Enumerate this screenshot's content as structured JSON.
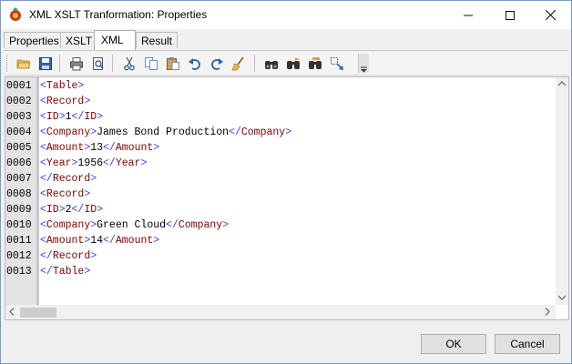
{
  "window": {
    "title": "XML XSLT Tranformation: Properties"
  },
  "tabs": [
    {
      "label": "Properties"
    },
    {
      "label": "XSLT"
    },
    {
      "label": "XML"
    },
    {
      "label": "Result"
    }
  ],
  "active_tab": "XML",
  "toolbar": {
    "items": [
      "open-folder-icon",
      "save-icon",
      "print-icon",
      "print-preview-icon",
      "cut-icon",
      "copy-icon",
      "paste-icon",
      "undo-icon",
      "redo-icon",
      "clear-icon",
      "find-icon",
      "find-next-icon",
      "replace-icon",
      "goto-icon"
    ]
  },
  "editor": {
    "lines": [
      {
        "num": "0001",
        "tokens": [
          [
            "<",
            "br"
          ],
          [
            "Table",
            "tag"
          ],
          [
            ">",
            "br"
          ]
        ]
      },
      {
        "num": "0002",
        "tokens": [
          [
            "<",
            "br"
          ],
          [
            "Record",
            "tag"
          ],
          [
            ">",
            "br"
          ]
        ]
      },
      {
        "num": "0003",
        "tokens": [
          [
            "<",
            "br"
          ],
          [
            "ID",
            "tag"
          ],
          [
            ">",
            "br"
          ],
          [
            "1",
            "txt"
          ],
          [
            "</",
            "br"
          ],
          [
            "ID",
            "tag"
          ],
          [
            ">",
            "br"
          ]
        ]
      },
      {
        "num": "0004",
        "tokens": [
          [
            "<",
            "br"
          ],
          [
            "Company",
            "tag"
          ],
          [
            ">",
            "br"
          ],
          [
            "James Bond Production",
            "txt"
          ],
          [
            "</",
            "br"
          ],
          [
            "Company",
            "tag"
          ],
          [
            ">",
            "br"
          ]
        ]
      },
      {
        "num": "0005",
        "tokens": [
          [
            "<",
            "br"
          ],
          [
            "Amount",
            "tag"
          ],
          [
            ">",
            "br"
          ],
          [
            "13",
            "txt"
          ],
          [
            "</",
            "br"
          ],
          [
            "Amount",
            "tag"
          ],
          [
            ">",
            "br"
          ]
        ]
      },
      {
        "num": "0006",
        "tokens": [
          [
            "<",
            "br"
          ],
          [
            "Year",
            "tag"
          ],
          [
            ">",
            "br"
          ],
          [
            "1956",
            "txt"
          ],
          [
            "</",
            "br"
          ],
          [
            "Year",
            "tag"
          ],
          [
            ">",
            "br"
          ]
        ]
      },
      {
        "num": "0007",
        "tokens": [
          [
            "</",
            "br"
          ],
          [
            "Record",
            "tag"
          ],
          [
            ">",
            "br"
          ]
        ]
      },
      {
        "num": "0008",
        "tokens": [
          [
            "<",
            "br"
          ],
          [
            "Record",
            "tag"
          ],
          [
            ">",
            "br"
          ]
        ]
      },
      {
        "num": "0009",
        "tokens": [
          [
            "<",
            "br"
          ],
          [
            "ID",
            "tag"
          ],
          [
            ">",
            "br"
          ],
          [
            "2",
            "txt"
          ],
          [
            "</",
            "br"
          ],
          [
            "ID",
            "tag"
          ],
          [
            ">",
            "br"
          ]
        ]
      },
      {
        "num": "0010",
        "tokens": [
          [
            "<",
            "br"
          ],
          [
            "Company",
            "tag"
          ],
          [
            ">",
            "br"
          ],
          [
            "Green Cloud",
            "txt"
          ],
          [
            "</",
            "br"
          ],
          [
            "Company",
            "tag"
          ],
          [
            ">",
            "br"
          ]
        ]
      },
      {
        "num": "0011",
        "tokens": [
          [
            "<",
            "br"
          ],
          [
            "Amount",
            "tag"
          ],
          [
            ">",
            "br"
          ],
          [
            "14",
            "txt"
          ],
          [
            "</",
            "br"
          ],
          [
            "Amount",
            "tag"
          ],
          [
            ">",
            "br"
          ]
        ]
      },
      {
        "num": "0012",
        "tokens": [
          [
            "</",
            "br"
          ],
          [
            "Record",
            "tag"
          ],
          [
            ">",
            "br"
          ]
        ]
      },
      {
        "num": "0013",
        "tokens": [
          [
            "</",
            "br"
          ],
          [
            "Table",
            "tag"
          ],
          [
            ">",
            "br"
          ]
        ]
      }
    ]
  },
  "buttons": {
    "ok": "OK",
    "cancel": "Cancel"
  },
  "colors": {
    "tag": "#800000",
    "bracket": "#3a3aff"
  }
}
